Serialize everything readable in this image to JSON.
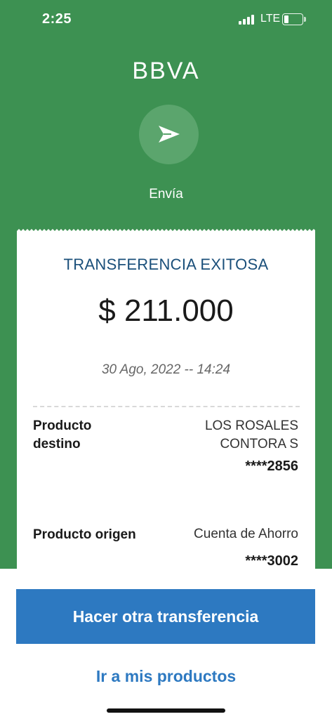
{
  "status_bar": {
    "time": "2:25",
    "network": "LTE",
    "icons": [
      "signal-icon",
      "battery-icon"
    ]
  },
  "header": {
    "logo_text": "BBVA",
    "action_icon": "send-icon",
    "action_label": "Envía"
  },
  "receipt": {
    "title": "TRANSFERENCIA EXITOSA",
    "amount": "$ 211.000",
    "datetime": "30 Ago, 2022 -- 14:24",
    "rows": [
      {
        "label_line1": "Producto",
        "label_line2": "destino",
        "value_line1": "LOS ROSALES",
        "value_line2": "CONTORA S",
        "account": "****2856"
      },
      {
        "label_line1": "Producto origen",
        "value_line1": "Cuenta de Ahorro",
        "account": "****3002"
      }
    ]
  },
  "actions": {
    "primary_label": "Hacer otra transferencia",
    "secondary_label": "Ir a mis productos"
  },
  "colors": {
    "background_green": "#3d9152",
    "title_blue": "#1a4f7a",
    "button_blue": "#2d79c1"
  }
}
